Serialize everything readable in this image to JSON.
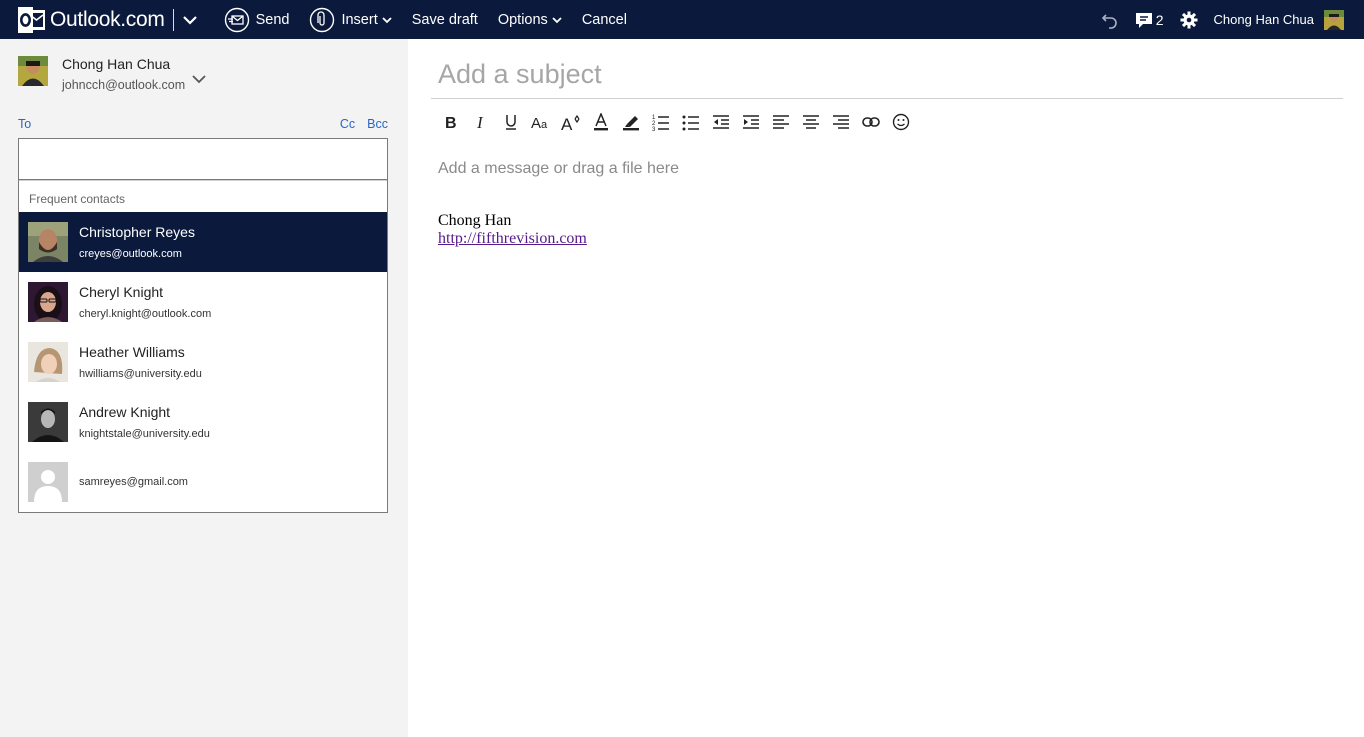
{
  "topbar": {
    "app_name": "Outlook.com",
    "send_label": "Send",
    "insert_label": "Insert",
    "save_draft_label": "Save draft",
    "options_label": "Options",
    "cancel_label": "Cancel",
    "notification_count": "2",
    "user_name": "Chong Han Chua"
  },
  "from": {
    "name": "Chong Han Chua",
    "email": "johncch@outlook.com"
  },
  "recipients": {
    "to_label": "To",
    "cc_label": "Cc",
    "bcc_label": "Bcc",
    "to_value": ""
  },
  "contacts": {
    "header": "Frequent contacts",
    "items": [
      {
        "name": "Christopher Reyes",
        "email": "creyes@outlook.com",
        "selected": true
      },
      {
        "name": "Cheryl Knight",
        "email": "cheryl.knight@outlook.com"
      },
      {
        "name": "Heather Williams",
        "email": "hwilliams@university.edu"
      },
      {
        "name": "Andrew Knight",
        "email": "knightstale@university.edu"
      },
      {
        "name": "",
        "email": "samreyes@gmail.com"
      }
    ]
  },
  "compose": {
    "subject_placeholder": "Add a subject",
    "body_placeholder": "Add a message or drag a file here",
    "signature_name": "Chong Han",
    "signature_link": "http://fifthrevision.com"
  },
  "toolbar_icons": [
    "bold-icon",
    "italic-icon",
    "underline-icon",
    "font-size-icon",
    "grow-font-icon",
    "font-color-icon",
    "highlight-icon",
    "numbered-list-icon",
    "bullet-list-icon",
    "decrease-indent-icon",
    "increase-indent-icon",
    "align-left-icon",
    "align-center-icon",
    "align-right-icon",
    "link-icon",
    "emoji-icon"
  ],
  "colors": {
    "topbar": "#0b1a3c",
    "left_pane": "#f3f3f3",
    "link": "#2a65c6",
    "selected_row": "#0b1a3c"
  }
}
